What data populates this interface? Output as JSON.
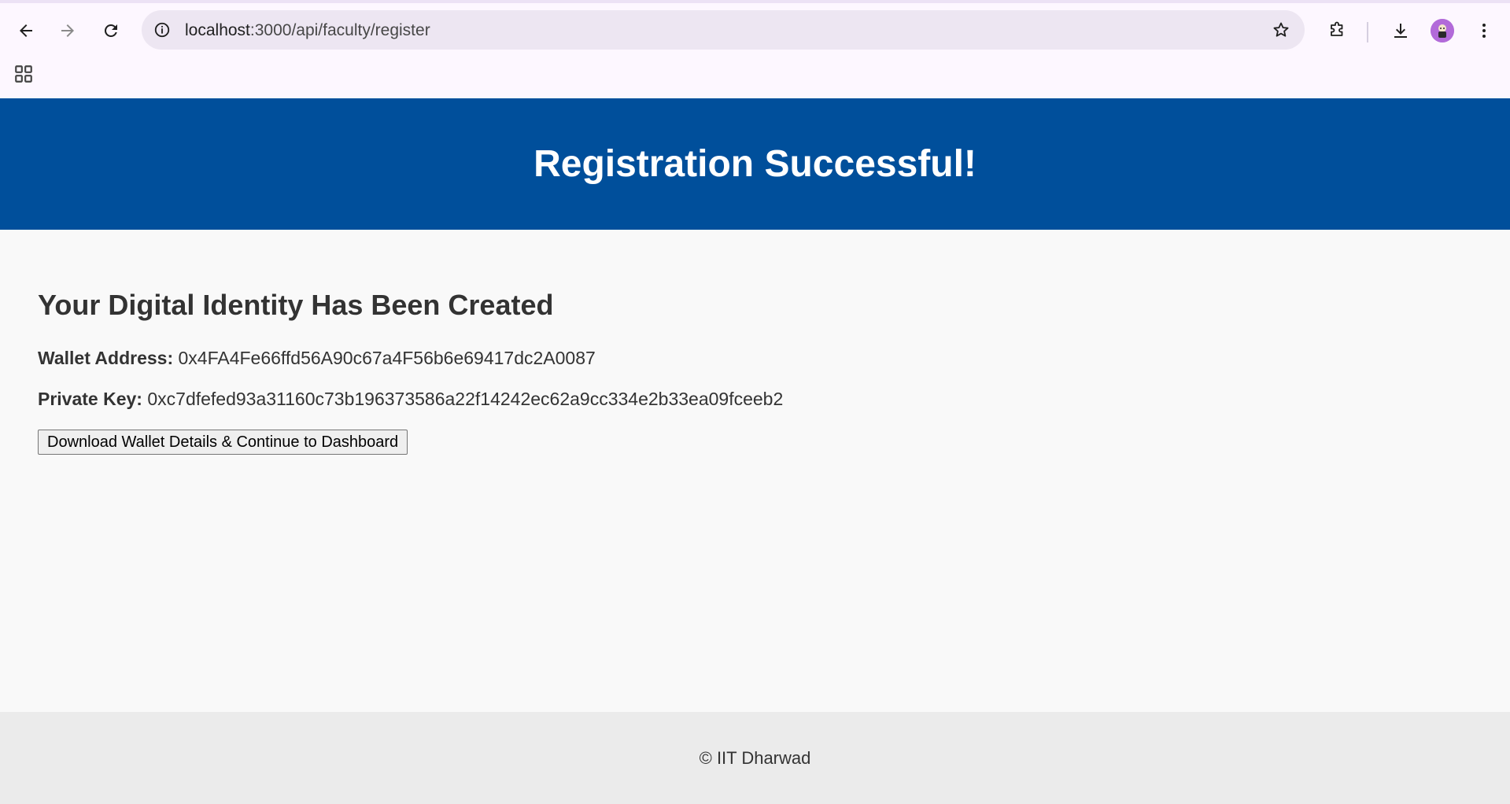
{
  "browser": {
    "url_host": "localhost",
    "url_path": ":3000/api/faculty/register"
  },
  "header": {
    "title": "Registration Successful!"
  },
  "main": {
    "heading": "Your Digital Identity Has Been Created",
    "wallet_label": "Wallet Address:",
    "wallet_value": "0x4FA4Fe66ffd56A90c67a4F56b6e69417dc2A0087",
    "key_label": "Private Key:",
    "key_value": "0xc7dfefed93a31160c73b196373586a22f14242ec62a9cc334e2b33ea09fceeb2",
    "button_label": "Download Wallet Details & Continue to Dashboard"
  },
  "footer": {
    "text": "© IIT Dharwad"
  },
  "colors": {
    "header_bg": "#004f9b",
    "footer_bg": "#ebebeb",
    "page_bg": "#f9f9f9",
    "chrome_bg": "#fdf7ff"
  },
  "icons": [
    "back-icon",
    "forward-icon",
    "reload-icon",
    "site-info-icon",
    "bookmark-star-icon",
    "extensions-icon",
    "download-icon",
    "profile-avatar",
    "menu-icon",
    "apps-grid-icon"
  ]
}
